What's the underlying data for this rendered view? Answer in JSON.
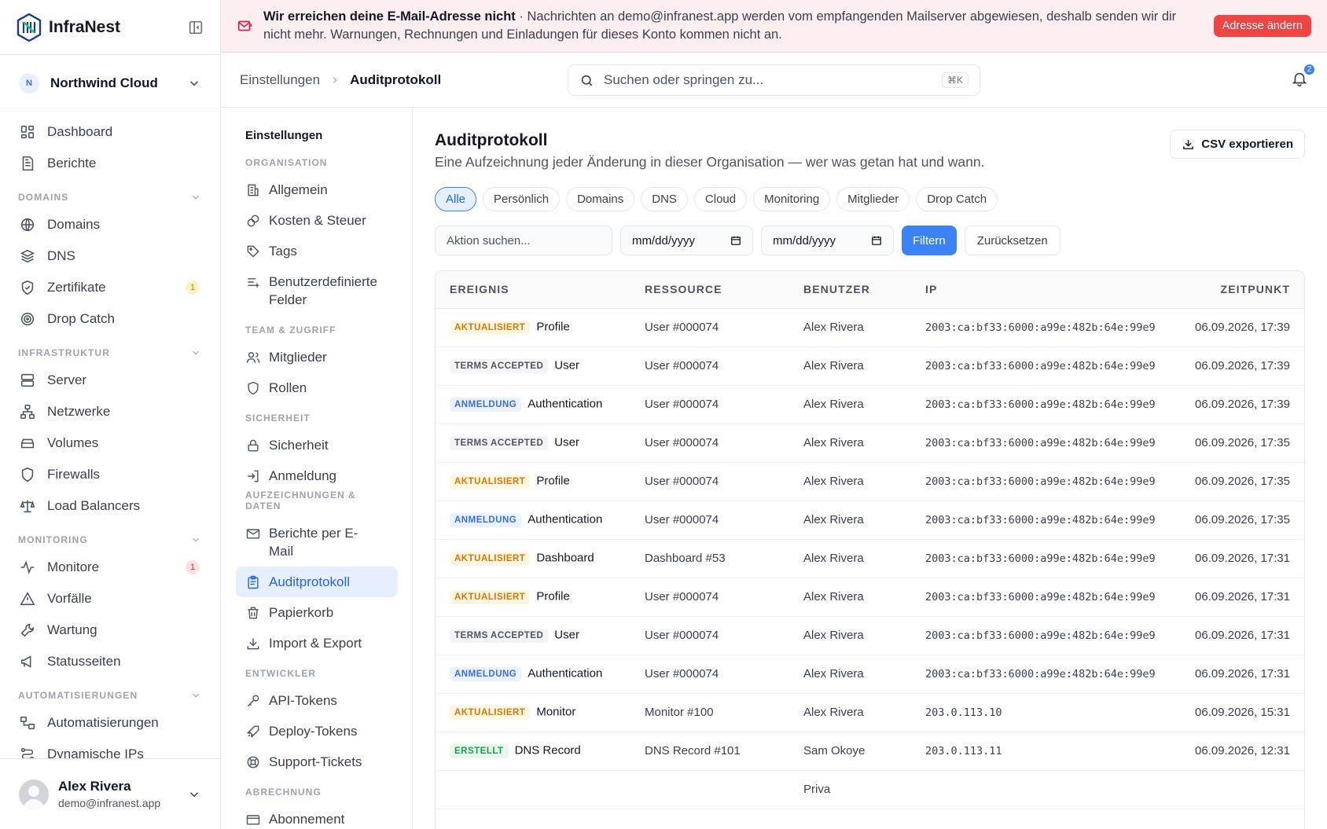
{
  "brand": {
    "name": "InfraNest"
  },
  "org": {
    "initial": "N",
    "name": "Northwind Cloud"
  },
  "nav": {
    "top": [
      {
        "label": "Dashboard",
        "icon": "dashboard-icon"
      },
      {
        "label": "Berichte",
        "icon": "report-icon"
      }
    ],
    "domains": {
      "title": "DOMAINS",
      "items": [
        {
          "label": "Domains",
          "icon": "globe-icon"
        },
        {
          "label": "DNS",
          "icon": "layers-icon"
        },
        {
          "label": "Zertifikate",
          "icon": "shield-check-icon",
          "badge": "1"
        },
        {
          "label": "Drop Catch",
          "icon": "target-icon"
        }
      ]
    },
    "infra": {
      "title": "INFRASTRUKTUR",
      "items": [
        {
          "label": "Server",
          "icon": "server-icon"
        },
        {
          "label": "Netzwerke",
          "icon": "network-icon"
        },
        {
          "label": "Volumes",
          "icon": "volume-icon"
        },
        {
          "label": "Firewalls",
          "icon": "shield-icon"
        },
        {
          "label": "Load Balancers",
          "icon": "scale-icon"
        }
      ]
    },
    "monitoring": {
      "title": "MONITORING",
      "items": [
        {
          "label": "Monitore",
          "icon": "activity-icon",
          "badge": "1"
        },
        {
          "label": "Vorfälle",
          "icon": "warning-icon"
        },
        {
          "label": "Wartung",
          "icon": "wrench-icon"
        },
        {
          "label": "Statusseiten",
          "icon": "megaphone-icon"
        }
      ]
    },
    "auto": {
      "title": "AUTOMATISIERUNGEN",
      "items": [
        {
          "label": "Automatisierungen",
          "icon": "workflow-icon"
        },
        {
          "label": "Dynamische IPs",
          "icon": "dynamic-ip-icon"
        }
      ]
    }
  },
  "user": {
    "name": "Alex Rivera",
    "email": "demo@infranest.app"
  },
  "banner": {
    "title": "Wir erreichen deine E-Mail-Adresse nicht",
    "text": " · Nachrichten an demo@infranest.app werden vom empfangenden Mailserver abgewiesen, deshalb senden wir dir nicht mehr. Warnungen, Rechnungen und Einladungen für dieses Konto kommen nicht an.",
    "button": "Adresse ändern"
  },
  "breadcrumb": {
    "parent": "Einstellungen",
    "current": "Auditprotokoll"
  },
  "search": {
    "placeholder": "Suchen oder springen zu...",
    "shortcut": "⌘K"
  },
  "notifications": {
    "count": "2"
  },
  "settings": {
    "title": "Einstellungen",
    "groups": [
      {
        "title": "ORGANISATION",
        "items": [
          {
            "label": "Allgemein",
            "icon": "building-icon"
          },
          {
            "label": "Kosten & Steuer",
            "icon": "coins-icon"
          },
          {
            "label": "Tags",
            "icon": "tag-icon"
          },
          {
            "label": "Benutzerdefinierte Felder",
            "icon": "fields-icon"
          }
        ]
      },
      {
        "title": "TEAM & ZUGRIFF",
        "items": [
          {
            "label": "Mitglieder",
            "icon": "users-icon"
          },
          {
            "label": "Rollen",
            "icon": "shield-icon"
          }
        ]
      },
      {
        "title": "SICHERHEIT",
        "items": [
          {
            "label": "Sicherheit",
            "icon": "lock-icon"
          },
          {
            "label": "Anmeldung",
            "icon": "login-icon"
          }
        ]
      },
      {
        "title": "AUFZEICHNUNGEN & DATEN",
        "items": [
          {
            "label": "Berichte per E-Mail",
            "icon": "mail-icon"
          },
          {
            "label": "Auditprotokoll",
            "icon": "clipboard-icon",
            "active": true
          },
          {
            "label": "Papierkorb",
            "icon": "trash-icon"
          },
          {
            "label": "Import & Export",
            "icon": "download-icon"
          }
        ]
      },
      {
        "title": "ENTWICKLER",
        "items": [
          {
            "label": "API-Tokens",
            "icon": "key-icon"
          },
          {
            "label": "Deploy-Tokens",
            "icon": "rocket-icon"
          },
          {
            "label": "Support-Tickets",
            "icon": "lifebuoy-icon"
          }
        ]
      },
      {
        "title": "ABRECHNUNG",
        "items": [
          {
            "label": "Abonnement",
            "icon": "card-icon"
          }
        ]
      }
    ]
  },
  "page": {
    "title": "Auditprotokoll",
    "subtitle": "Eine Aufzeichnung jeder Änderung in dieser Organisation — wer was getan hat und wann.",
    "export": "CSV exportieren"
  },
  "chips": [
    "Alle",
    "Persönlich",
    "Domains",
    "DNS",
    "Cloud",
    "Monitoring",
    "Mitglieder",
    "Drop Catch"
  ],
  "filters": {
    "action_placeholder": "Aktion suchen...",
    "date_from": "mm/dd/yyyy",
    "date_to": "mm/dd/yyyy",
    "apply": "Filtern",
    "reset": "Zurücksetzen"
  },
  "table": {
    "headers": [
      "EREIGNIS",
      "RESSOURCE",
      "BENUTZER",
      "IP",
      "ZEITPUNKT"
    ],
    "rows": [
      {
        "tag": "AKTUALISIERT",
        "tagType": "upd",
        "event": "Profile",
        "resource": "User #000074",
        "user": "Alex Rivera",
        "ip": "2003:ca:bf33:6000:a99e:482b:64e:99e9",
        "time": "06.09.2026, 17:39"
      },
      {
        "tag": "TERMS ACCEPTED",
        "tagType": "terms",
        "event": "User",
        "resource": "User #000074",
        "user": "Alex Rivera",
        "ip": "2003:ca:bf33:6000:a99e:482b:64e:99e9",
        "time": "06.09.2026, 17:39"
      },
      {
        "tag": "ANMELDUNG",
        "tagType": "login",
        "event": "Authentication",
        "resource": "User #000074",
        "user": "Alex Rivera",
        "ip": "2003:ca:bf33:6000:a99e:482b:64e:99e9",
        "time": "06.09.2026, 17:39"
      },
      {
        "tag": "TERMS ACCEPTED",
        "tagType": "terms",
        "event": "User",
        "resource": "User #000074",
        "user": "Alex Rivera",
        "ip": "2003:ca:bf33:6000:a99e:482b:64e:99e9",
        "time": "06.09.2026, 17:35"
      },
      {
        "tag": "AKTUALISIERT",
        "tagType": "upd",
        "event": "Profile",
        "resource": "User #000074",
        "user": "Alex Rivera",
        "ip": "2003:ca:bf33:6000:a99e:482b:64e:99e9",
        "time": "06.09.2026, 17:35"
      },
      {
        "tag": "ANMELDUNG",
        "tagType": "login",
        "event": "Authentication",
        "resource": "User #000074",
        "user": "Alex Rivera",
        "ip": "2003:ca:bf33:6000:a99e:482b:64e:99e9",
        "time": "06.09.2026, 17:35"
      },
      {
        "tag": "AKTUALISIERT",
        "tagType": "upd",
        "event": "Dashboard",
        "resource": "Dashboard #53",
        "user": "Alex Rivera",
        "ip": "2003:ca:bf33:6000:a99e:482b:64e:99e9",
        "time": "06.09.2026, 17:31"
      },
      {
        "tag": "AKTUALISIERT",
        "tagType": "upd",
        "event": "Profile",
        "resource": "User #000074",
        "user": "Alex Rivera",
        "ip": "2003:ca:bf33:6000:a99e:482b:64e:99e9",
        "time": "06.09.2026, 17:31"
      },
      {
        "tag": "TERMS ACCEPTED",
        "tagType": "terms",
        "event": "User",
        "resource": "User #000074",
        "user": "Alex Rivera",
        "ip": "2003:ca:bf33:6000:a99e:482b:64e:99e9",
        "time": "06.09.2026, 17:31"
      },
      {
        "tag": "ANMELDUNG",
        "tagType": "login",
        "event": "Authentication",
        "resource": "User #000074",
        "user": "Alex Rivera",
        "ip": "2003:ca:bf33:6000:a99e:482b:64e:99e9",
        "time": "06.09.2026, 17:31"
      },
      {
        "tag": "AKTUALISIERT",
        "tagType": "upd",
        "event": "Monitor",
        "resource": "Monitor #100",
        "user": "Alex Rivera",
        "ip": "203.0.113.10",
        "time": "06.09.2026, 15:31"
      },
      {
        "tag": "ERSTELLT",
        "tagType": "new",
        "event": "DNS Record",
        "resource": "DNS Record #101",
        "user": "Sam Okoye",
        "ip": "203.0.113.11",
        "time": "06.09.2026, 12:31"
      },
      {
        "tag": "",
        "tagType": "new",
        "event": "",
        "resource": "",
        "user": "Priva",
        "ip": "",
        "time": ""
      }
    ]
  }
}
